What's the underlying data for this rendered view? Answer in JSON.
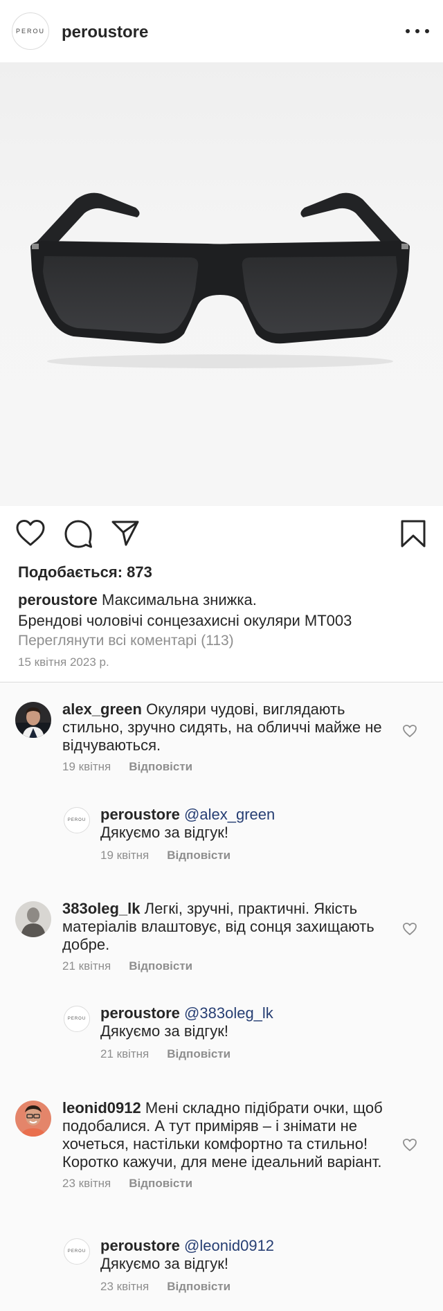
{
  "header": {
    "username": "peroustore",
    "logo_text": "PEROU",
    "more_icon": "more-horizontal-icon"
  },
  "post": {
    "image_alt": "Matte black rectangular sunglasses",
    "likes_label": "Подобається: 873",
    "caption_user": "peroustore",
    "caption_text": " Максимальна знижка.",
    "caption_text_line2": "Брендові чоловічі сонцезахисні окуляри MT003",
    "view_all_comments": "Переглянути всі коментарі (113)",
    "date": "15 квітня 2023 р.",
    "icons": [
      "heart-icon",
      "comment-icon",
      "share-icon",
      "bookmark-icon"
    ]
  },
  "comments": [
    {
      "user": "alex_green",
      "text": " Окуляри чудові, виглядають стильно, зручно сидять, на обличчі майже не відчуваються.",
      "date": "19 квітня",
      "reply_label": "Відповісти",
      "reply": {
        "user": "peroustore",
        "mention": "@alex_green",
        "text": "Дякуємо за відгук!",
        "date": "19 квітня",
        "reply_label": "Відповісти"
      }
    },
    {
      "user": "383oleg_lk",
      "text": " Легкі, зручні, практичні. Якість матеріалів влаштовує, від сонця захищають добре.",
      "date": "21 квітня",
      "reply_label": "Відповісти",
      "reply": {
        "user": "peroustore",
        "mention": "@383oleg_lk",
        "text": "Дякуємо за відгук!",
        "date": "21 квітня",
        "reply_label": "Відповісти"
      }
    },
    {
      "user": "leonid0912",
      "text": "  Мені складно підібрати очки, щоб подобалися. А тут приміряв – і знімати не хочеться, настільки комфортно та стильно! Коротко кажучи, для мене ідеальний варіант.",
      "date": "23 квітня",
      "reply_label": "Відповісти",
      "reply": {
        "user": "peroustore",
        "mention": "@leonid0912",
        "text": "Дякуємо за відгук!",
        "date": "23 квітня",
        "reply_label": "Відповісти"
      }
    }
  ],
  "colors": {
    "text": "#262626",
    "muted": "#8e8e8e",
    "mention": "#263e73",
    "divider": "#dbdbdb"
  }
}
